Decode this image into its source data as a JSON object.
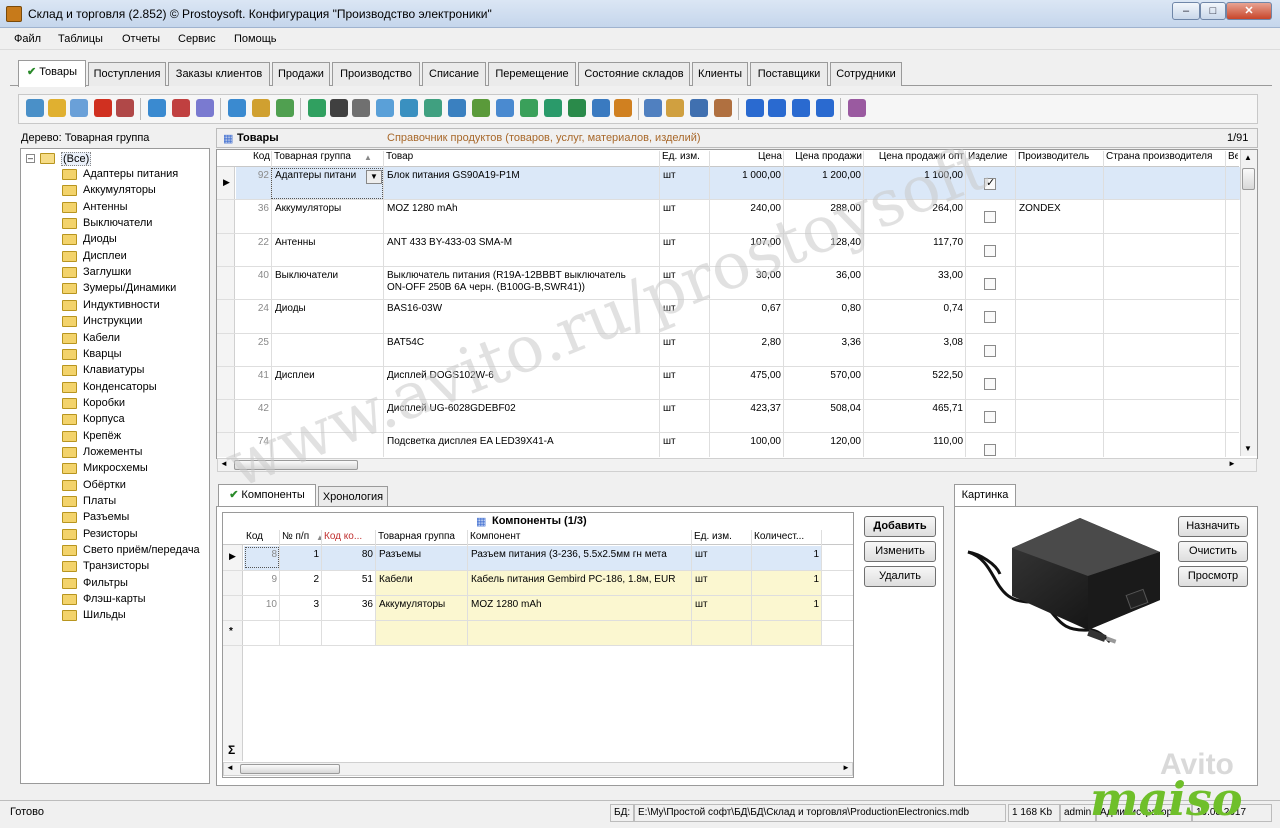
{
  "window": {
    "title": "Склад и торговля (2.852) © Prostoysoft. Конфигурация \"Производство электроники\"",
    "minimize": "–",
    "maximize": "□",
    "close": "✕"
  },
  "menu": [
    "Файл",
    "Таблицы",
    "Отчеты",
    "Сервис",
    "Помощь"
  ],
  "tabs": [
    "Товары",
    "Поступления",
    "Заказы клиентов",
    "Продажи",
    "Производство",
    "Списание",
    "Перемещение",
    "Состояние складов",
    "Клиенты",
    "Поставщики",
    "Сотрудники"
  ],
  "tree": {
    "label": "Дерево: Товарная группа",
    "root": "(Все)",
    "items": [
      "Адаптеры питания",
      "Аккумуляторы",
      "Антенны",
      "Выключатели",
      "Диоды",
      "Дисплеи",
      "Заглушки",
      "Зумеры/Динамики",
      "Индуктивности",
      "Инструкции",
      "Кабели",
      "Кварцы",
      "Клавиатуры",
      "Конденсаторы",
      "Коробки",
      "Корпуса",
      "Крепёж",
      "Ложементы",
      "Микросхемы",
      "Обёртки",
      "Платы",
      "Разъемы",
      "Резисторы",
      "Свето приём/передача",
      "Транзисторы",
      "Фильтры",
      "Флэш-карты",
      "Шильды"
    ]
  },
  "grid": {
    "title": "Товары",
    "subtitle": "Справочник продуктов (товаров, услуг, материалов, изделий)",
    "counter": "1/91",
    "columns": [
      "Код",
      "Товарная группа",
      "Товар",
      "Ед. изм.",
      "Цена",
      "Цена продажи",
      "Цена продажи опт",
      "Изделие",
      "Производитель",
      "Страна производителя",
      "Ве"
    ],
    "rows": [
      {
        "code": "92",
        "group": "Адаптеры питани",
        "product": "Блок питания GS90A19-P1M",
        "unit": "шт",
        "price": "1 000,00",
        "sale": "1 200,00",
        "opt": "1 100,00",
        "item": true,
        "maker": ""
      },
      {
        "code": "36",
        "group": "Аккумуляторы",
        "product": "MOZ  1280 mAh",
        "unit": "шт",
        "price": "240,00",
        "sale": "288,00",
        "opt": "264,00",
        "item": false,
        "maker": "ZONDEX"
      },
      {
        "code": "22",
        "group": "Антенны",
        "product": "ANT 433 BY-433-03 SMA-M",
        "unit": "шт",
        "price": "107,00",
        "sale": "128,40",
        "opt": "117,70",
        "item": false,
        "maker": ""
      },
      {
        "code": "40",
        "group": "Выключатели",
        "product": "Выключатель питания (R19A-12BBBT выключатель",
        "product2": "ON-OFF 250В 6А черн. (B100G-B,SWR41))",
        "unit": "шт",
        "price": "30,00",
        "sale": "36,00",
        "opt": "33,00",
        "item": false,
        "maker": ""
      },
      {
        "code": "24",
        "group": "Диоды",
        "product": "BAS16-03W",
        "unit": "шт",
        "price": "0,67",
        "sale": "0,80",
        "opt": "0,74",
        "item": false,
        "maker": ""
      },
      {
        "code": "25",
        "group": "",
        "product": "BAT54C",
        "unit": "шт",
        "price": "2,80",
        "sale": "3,36",
        "opt": "3,08",
        "item": false,
        "maker": ""
      },
      {
        "code": "41",
        "group": "Дисплеи",
        "product": "Дисплей DOGS102W-6",
        "unit": "шт",
        "price": "475,00",
        "sale": "570,00",
        "opt": "522,50",
        "item": false,
        "maker": ""
      },
      {
        "code": "42",
        "group": "",
        "product": "Дисплей UG-6028GDEBF02",
        "unit": "шт",
        "price": "423,37",
        "sale": "508,04",
        "opt": "465,71",
        "item": false,
        "maker": ""
      },
      {
        "code": "74",
        "group": "",
        "product": "Подсветка дисплея EA LED39X41-A",
        "unit": "шт",
        "price": "100,00",
        "sale": "120,00",
        "opt": "110,00",
        "item": false,
        "maker": ""
      }
    ]
  },
  "components": {
    "tabs": [
      "Компоненты",
      "Хронология"
    ],
    "title": "Компоненты (1/3)",
    "columns": [
      "Код",
      "№ п/п",
      "Код ко...",
      "Товарная группа",
      "Компонент",
      "Ед. изм.",
      "Количест..."
    ],
    "rows": [
      {
        "code": "8",
        "n": "1",
        "cc": "80",
        "group": "Разъемы",
        "comp": "Разъем питания (3-236, 5.5х2.5мм гн мета",
        "unit": "шт",
        "qty": "1"
      },
      {
        "code": "9",
        "n": "2",
        "cc": "51",
        "group": "Кабели",
        "comp": "Кабель питания Gembird PC-186, 1.8м, EUR",
        "unit": "шт",
        "qty": "1"
      },
      {
        "code": "10",
        "n": "3",
        "cc": "36",
        "group": "Аккумуляторы",
        "comp": "MOZ  1280 mAh",
        "unit": "шт",
        "qty": "1"
      }
    ],
    "new_row_marker": "*",
    "sum_marker": "Σ",
    "buttons": [
      "Добавить",
      "Изменить",
      "Удалить"
    ]
  },
  "picture": {
    "tab": "Картинка",
    "buttons": [
      "Назначить",
      "Очистить",
      "Просмотр"
    ]
  },
  "status": {
    "ready": "Готово",
    "db_label": "БД:",
    "db_path": "E:\\My\\Простой софт\\БД\\БД\\Склад и торговля\\ProductionElectronics.mdb",
    "size": "1 168 Kb",
    "user": "admin",
    "role": "Администратор",
    "date": "19.08.2017"
  },
  "watermark": "www.avito.ru/prostoysoft",
  "logos": {
    "avito": "Avito",
    "maiso": "maiso"
  }
}
